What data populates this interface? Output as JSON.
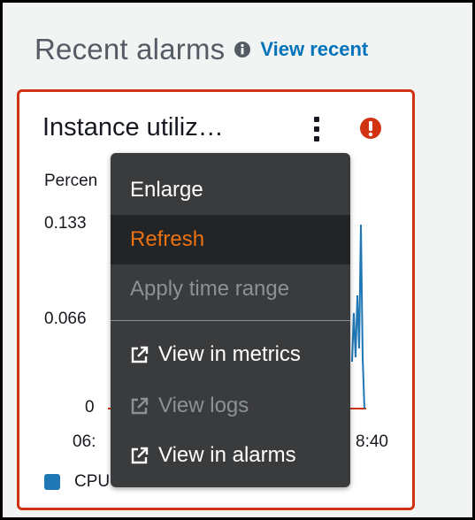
{
  "section": {
    "title": "Recent alarms",
    "info_icon": "info-circle-icon",
    "link_label": "View recent"
  },
  "widget": {
    "title": "Instance utiliz…",
    "menu_icon": "vertical-ellipsis-icon",
    "status_icon": "alarm-exclamation-icon",
    "status_color": "#d13212",
    "y_axis_label": "Percen",
    "y_ticks": [
      "0.133",
      "0.066",
      "0"
    ],
    "x_tick_left": "06:",
    "x_tick_right": "8:40",
    "legend_label": "CPU",
    "legend_color": "#1f77b4"
  },
  "context_menu": {
    "items": [
      {
        "label": "Enlarge",
        "state": "normal"
      },
      {
        "label": "Refresh",
        "state": "active"
      },
      {
        "label": "Apply time range",
        "state": "disabled"
      },
      {
        "label": "View in metrics",
        "state": "normal",
        "icon": "external-link-icon"
      },
      {
        "label": "View logs",
        "state": "disabled",
        "icon": "external-link-icon"
      },
      {
        "label": "View in alarms",
        "state": "normal",
        "icon": "external-link-icon"
      }
    ]
  },
  "colors": {
    "link": "#0073bb",
    "alarm_border": "#d13212",
    "menu_bg": "#3a3b3d",
    "menu_active_text": "#ec7211"
  }
}
